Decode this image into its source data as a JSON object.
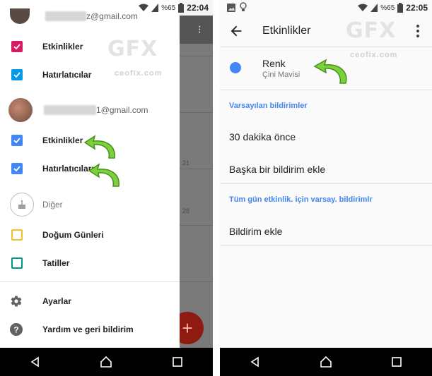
{
  "left_screen": {
    "status": {
      "battery_pct": "%65",
      "time": "22:04"
    },
    "accounts": [
      {
        "email_visible": "z@gmail.com"
      },
      {
        "email_visible": "1@gmail.com"
      }
    ],
    "account1_items": [
      {
        "label": "Etkinlikler",
        "color": "#d81b60",
        "checked": true
      },
      {
        "label": "Hatırlatıcılar",
        "color": "#039be5",
        "checked": true
      }
    ],
    "account2_items": [
      {
        "label": "Etkinlikler",
        "color": "#4285f4",
        "checked": true
      },
      {
        "label": "Hatırlatıcıları",
        "color": "#4285f4",
        "checked": true
      }
    ],
    "other_header": "Diğer",
    "other_items": [
      {
        "label": "Doğum Günleri",
        "color": "#f6bf26",
        "checked": false
      },
      {
        "label": "Tatiller",
        "color": "#009688",
        "checked": false
      }
    ],
    "footer_items": [
      {
        "label": "Ayarlar",
        "icon": "gear-icon"
      },
      {
        "label": "Yardım ve geri bildirim",
        "icon": "help-icon"
      }
    ],
    "behind_days": [
      "21",
      "28"
    ],
    "fab_label": "+"
  },
  "right_screen": {
    "status": {
      "battery_pct": "%65",
      "time": "22:05"
    },
    "title": "Etkinlikler",
    "color_setting": {
      "title": "Renk",
      "value": "Çini Mavisi",
      "color": "#4285f4"
    },
    "section_default": "Varsayılan bildirimler",
    "default_items": [
      "30 dakika önce",
      "Başka bir bildirim ekle"
    ],
    "section_allday": "Tüm gün etkinlik. için varsay. bildirimlr",
    "allday_items": [
      "Bildirim ekle"
    ]
  },
  "watermark": {
    "logo": "GFX",
    "site": "ceofix.com"
  },
  "accent_arrow_color": "#7bd13b"
}
